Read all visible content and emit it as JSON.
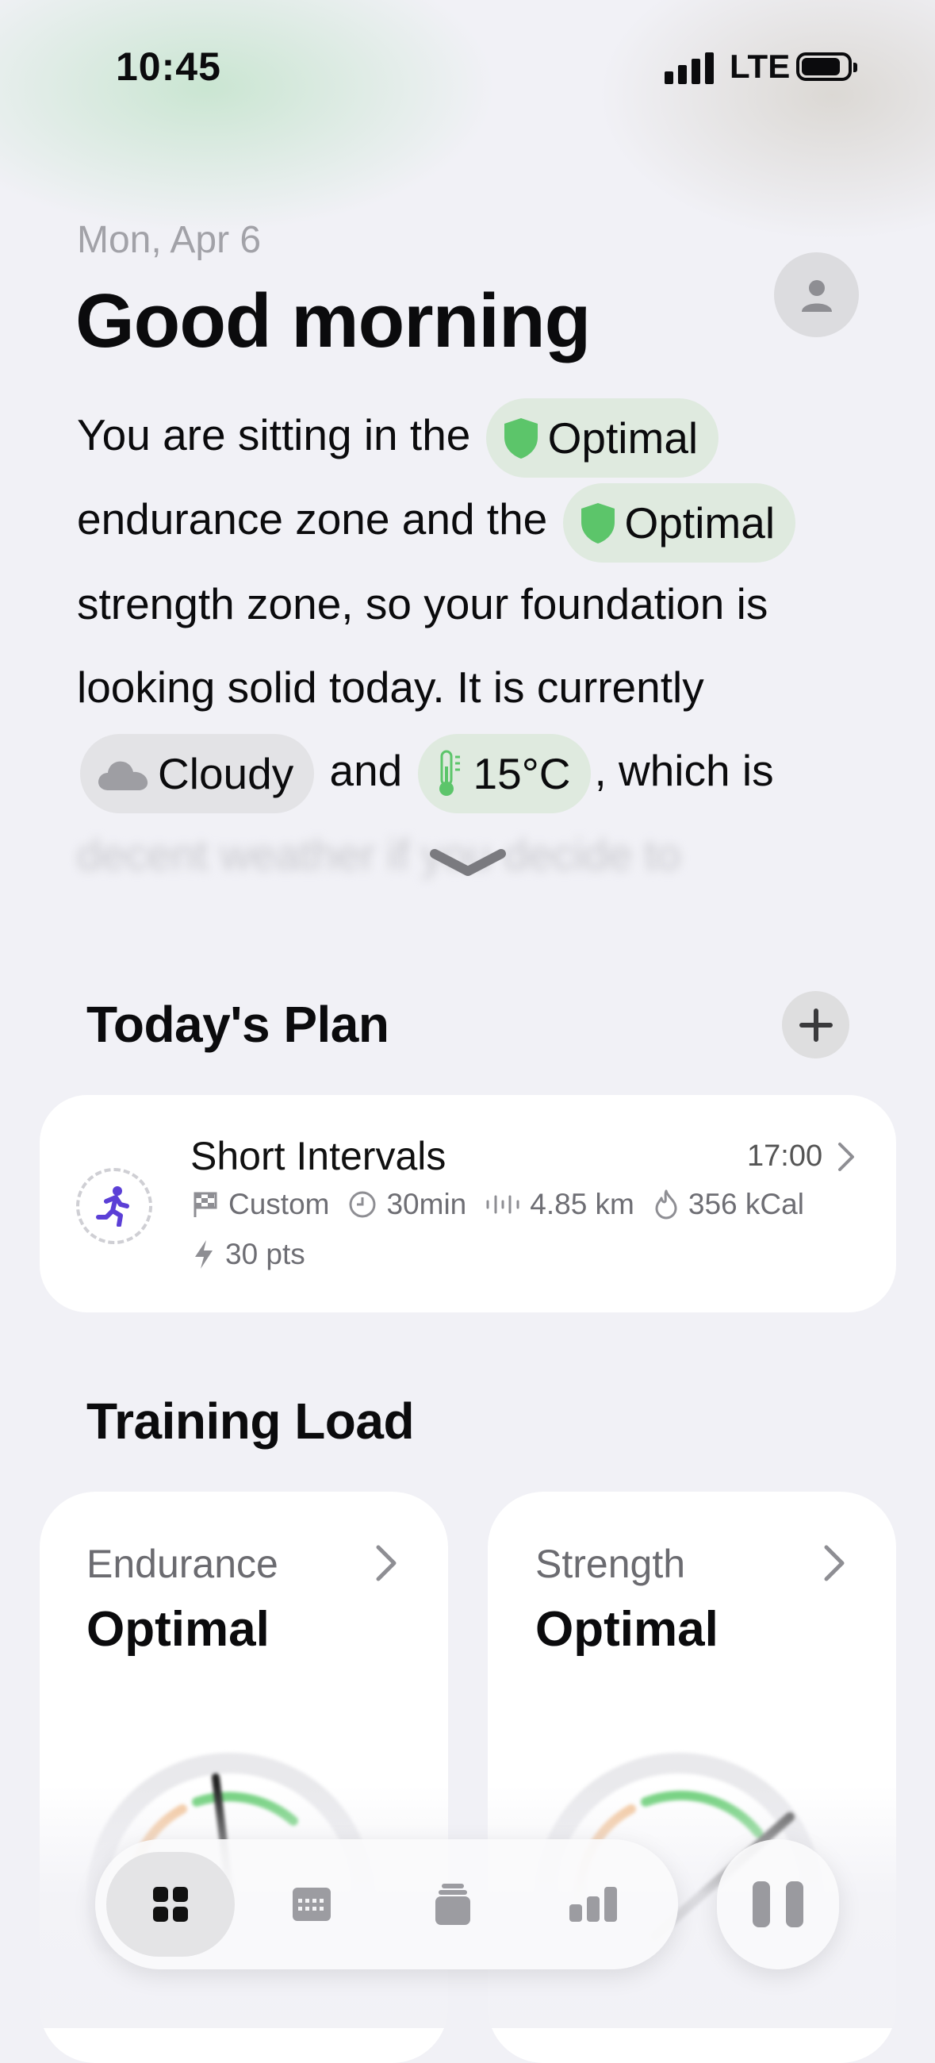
{
  "status_bar": {
    "time": "10:45",
    "network": "LTE"
  },
  "header": {
    "date": "Mon, Apr 6",
    "greeting": "Good morning"
  },
  "summary": {
    "t1": "You are sitting in the",
    "endurance_pill": "Optimal",
    "t2": "endurance zone and the",
    "strength_pill": "Optimal",
    "t3": "strength zone, so your foundation is looking solid today. It is currently",
    "weather_pill": "Cloudy",
    "t4": "and",
    "temp_pill": "15°C",
    "t5": ", which is",
    "t6": "decent weather if you decide to"
  },
  "plan": {
    "title": "Today's Plan",
    "workout": {
      "name": "Short Intervals",
      "time": "17:00",
      "type": "Custom",
      "duration": "30min",
      "distance": "4.85 km",
      "calories": "356 kCal",
      "points": "30 pts"
    }
  },
  "training_load": {
    "title": "Training Load",
    "cards": [
      {
        "label": "Endurance",
        "value": "Optimal"
      },
      {
        "label": "Strength",
        "value": "Optimal"
      }
    ]
  },
  "colors": {
    "accent_green": "#5cc56a",
    "run_icon": "#5b3fd6",
    "pill_green_bg": "#dfeadf"
  },
  "tabs": [
    "dashboard-icon",
    "calendar-icon",
    "library-icon",
    "stats-icon"
  ]
}
